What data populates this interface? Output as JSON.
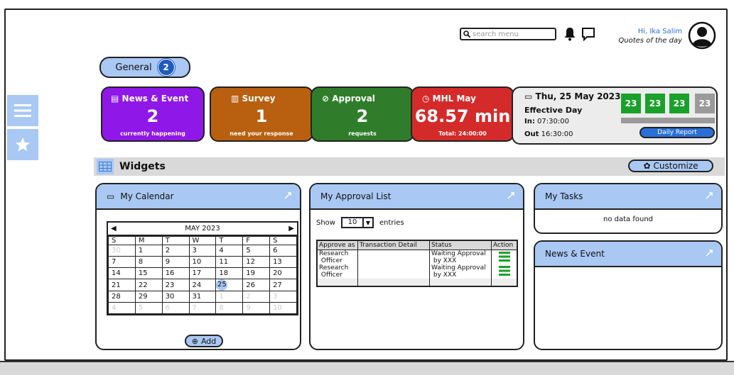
{
  "header": {
    "search_placeholder": "search menu",
    "greeting": "Hi, Ika Salim",
    "quote_link": "Quotes of the day"
  },
  "tabs": {
    "general_label": "General",
    "general_count": "2"
  },
  "cards": {
    "news": {
      "title": "News & Event",
      "value": "2",
      "sub": "currently happening",
      "color": "#8f17e8"
    },
    "survey": {
      "title": "Survey",
      "value": "1",
      "sub": "need your response",
      "color": "#b8600f"
    },
    "approval": {
      "title": "Approval",
      "value": "2",
      "sub": "requests",
      "color": "#2f7d2a"
    },
    "mhl": {
      "title": "MHL May",
      "value": "68.57 min",
      "sub": "Total: 24:00:00",
      "color": "#d42a2a"
    }
  },
  "day": {
    "date": "Thu, 25 May 2023",
    "label": "Effective Day",
    "in_label": "In:",
    "in_time": "07:30:00",
    "out_label": "Out",
    "out_time": "16:30:00",
    "boxes": [
      "23",
      "23",
      "23",
      "23"
    ],
    "report_button": "Daily Report"
  },
  "widgets": {
    "title": "Widgets",
    "customize": "Customize"
  },
  "calendar": {
    "title": "My Calendar",
    "month": "MAY 2023",
    "days": [
      "S",
      "M",
      "T",
      "W",
      "T",
      "F",
      "S"
    ],
    "weeks": [
      [
        "30",
        "1",
        "2",
        "3",
        "4",
        "5",
        "6"
      ],
      [
        "7",
        "8",
        "9",
        "10",
        "11",
        "12",
        "13"
      ],
      [
        "14",
        "15",
        "16",
        "17",
        "18",
        "19",
        "20"
      ],
      [
        "21",
        "22",
        "23",
        "24",
        "25",
        "26",
        "27"
      ],
      [
        "28",
        "29",
        "30",
        "31",
        "1",
        "2",
        "3"
      ],
      [
        "4",
        "5",
        "6",
        "7",
        "8",
        "9",
        "10"
      ]
    ],
    "selected": "25",
    "add_label": "Add"
  },
  "approval_list": {
    "title": "My Approval List",
    "show_label": "Show",
    "entries_value": "10",
    "entries_label": "entries",
    "columns": [
      "Approve as",
      "Transaction Detail",
      "Status",
      "Action"
    ],
    "rows": [
      {
        "approve_as_1": "Research",
        "approve_as_2": "Officer",
        "detail": "",
        "status_1": "Waiting Approval",
        "status_2": "by XXX"
      },
      {
        "approve_as_1": "Research",
        "approve_as_2": "Officer",
        "detail": "",
        "status_1": "Waiting Approval",
        "status_2": "by XXX"
      }
    ]
  },
  "tasks": {
    "title": "My Tasks",
    "empty": "no data found"
  },
  "news_widget": {
    "title": "News & Event"
  }
}
